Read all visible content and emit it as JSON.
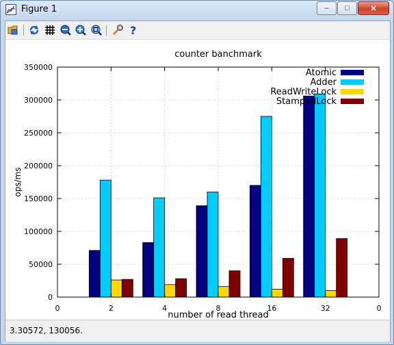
{
  "window": {
    "title": "Figure 1",
    "minimize": "–",
    "maximize": "□",
    "close": "✕"
  },
  "toolbar": {
    "icons": [
      "open-icon",
      "refresh-icon",
      "grid-icon",
      "zoom-out-icon",
      "zoom-in-icon",
      "zoom-fit-icon",
      "settings-wrench-icon",
      "help-icon"
    ]
  },
  "status": {
    "coordinates": "3.30572,  130056."
  },
  "colors": {
    "atomic": "#000080",
    "adder": "#00ccff",
    "readwritelock": "#ffd700",
    "stampedlock": "#800000"
  },
  "chart_data": {
    "type": "bar",
    "title": "counter banchmark",
    "xlabel": "number of read thread",
    "ylabel": "ops/ms",
    "categories": [
      "2",
      "4",
      "8",
      "16",
      "32"
    ],
    "x_axis_end_labels": [
      "0",
      "0"
    ],
    "ylim": [
      0,
      350000
    ],
    "yticks": [
      "0",
      "50000",
      "100000",
      "150000",
      "200000",
      "250000",
      "300000",
      "350000"
    ],
    "grid": true,
    "legend_position": "top-right",
    "series": [
      {
        "name": "Atomic",
        "values": [
          71000,
          83000,
          139000,
          170000,
          306000
        ]
      },
      {
        "name": "Adder",
        "values": [
          178000,
          151000,
          160000,
          275000,
          309000
        ]
      },
      {
        "name": "ReadWriteLock",
        "values": [
          26000,
          19000,
          16000,
          12000,
          10000
        ]
      },
      {
        "name": "StampedLock",
        "values": [
          27000,
          28000,
          40000,
          59000,
          89000
        ]
      }
    ]
  }
}
